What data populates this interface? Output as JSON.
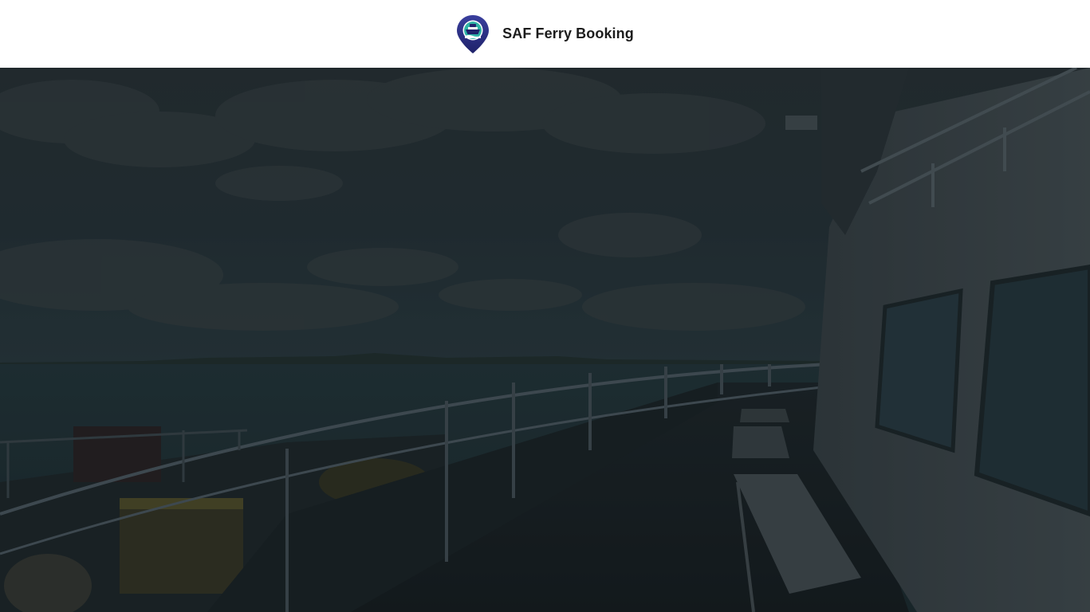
{
  "header": {
    "brand_name": "SAF Ferry Booking",
    "logo_icon": "ferry-location-pin-icon"
  },
  "hero": {
    "image": "ferry-deck-sea-view",
    "overlay": "dark"
  },
  "colors": {
    "header_bg": "#ffffff",
    "brand_text": "#1c1c1c",
    "logo_pin": "#2b2f86",
    "logo_accent": "#2fb3a6",
    "hero_overlay": "#121a1e"
  }
}
